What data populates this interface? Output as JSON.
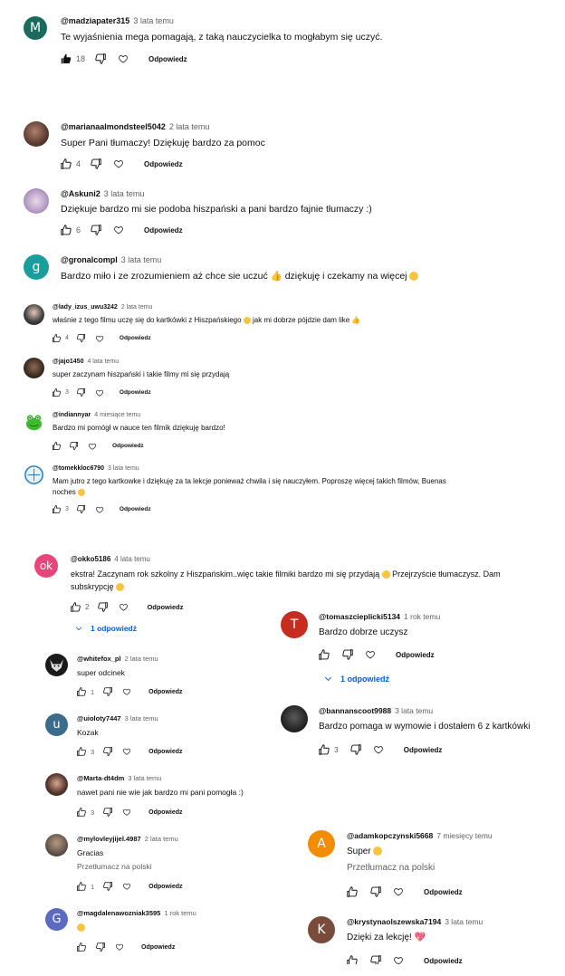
{
  "labels": {
    "reply": "Odpowiedz",
    "translate": "Przetłumacz na polski"
  },
  "colors": {
    "red": "#e8562f",
    "orange": "#f28c00",
    "green": "#1a9d8a",
    "pink": "#e8457a",
    "purple": "#5c6bc0",
    "brown": "#7a4b3a",
    "blue": "#065fd4"
  },
  "comments": [
    {
      "handle": "@madziapater315",
      "time": "3 lata temu",
      "text": "Te wyjaśnienia mega pomagają, z taką nauczycielka to mogłabym się uczyć.",
      "likes": "18",
      "avatar_letter": "M",
      "avatar_color": "#1a6b5e"
    },
    {
      "handle": "@marianaalmondsteel5042",
      "time": "2 lata temu",
      "text": "Super Pani tłumaczy! Dziękuję bardzo za pomoc",
      "likes": "4",
      "avatar_photo": "portrait"
    },
    {
      "handle": "@Askuni2",
      "time": "3 lata temu",
      "text": "Dziękuje bardzo mi sie podoba hiszpański a pani bardzo fajnie tłumaczy :)",
      "likes": "6",
      "avatar_photo": "anime"
    },
    {
      "handle": "@gronalcompl",
      "time": "3 lata temu",
      "text": "Bardzo miło i ze zrozumieniem aż chce sie uczuć",
      "text2": "dziękuję i czekamy na więcej",
      "avatar_letter": "g",
      "avatar_color": "#1a9d9d"
    },
    {
      "handle": "@lady_izus_uwu3242",
      "time": "2 lata temu",
      "text": "właśnie z tego filmu uczę się do kartkówki z Hiszpańskiego",
      "text2": "jak mi dobrze pójdzie dam like",
      "likes": "4",
      "avatar_photo": "portrait"
    },
    {
      "handle": "@jajo1450",
      "time": "4 lata temu",
      "text": "super zaczynam hiszpański i takie filmy mi się przydają",
      "likes": "3",
      "avatar_photo": "dark"
    },
    {
      "handle": "@indiannyar",
      "time": "4 miesiące temu",
      "text": "Bardzo mi pomógł w nauce ten filmik dziękuję bardzo!",
      "avatar_photo": "frog"
    },
    {
      "handle": "@tomekkloc6790",
      "time": "3 lata temu",
      "text": "Mam jutro z tego kartkowke i dziękuję za ta  lekcje ponieważ chwila i się nauczyłem. Poproszę więcej takich filmów, Buenas",
      "text2": "noches",
      "likes": "3",
      "avatar_photo": "logo"
    },
    {
      "handle": "@okko5186",
      "time": "4 lata temu",
      "text": "ekstra! Zaczynam rok szkolny z Hiszpańskim..więc takie filmiki bardzo mi się przydają",
      "text1b": "Przejrzyście tłumaczysz. Dam",
      "text2": "subskrypcję",
      "likes": "2",
      "avatar_letter": "ok",
      "avatar_color": "#e8457a",
      "replies": "1 odpowiedź"
    },
    {
      "handle": "@whitefox_pl",
      "time": "2 lata temu",
      "text": "super odcinek",
      "likes": "1",
      "avatar_photo": "fox"
    },
    {
      "handle": "@uioloty7447",
      "time": "3 lata temu",
      "text": "Kozak",
      "likes": "3",
      "avatar_letter": "u",
      "avatar_color": "#3c6c8c"
    },
    {
      "handle": "@Marta-dt4dm",
      "time": "3 lata temu",
      "text": "nawet pani nie wie jak bardzo mi pani pomogła :)",
      "likes": "3",
      "avatar_photo": "portrait"
    },
    {
      "handle": "@mylovleyjijel.4987",
      "time": "2 lata temu",
      "text": "Gracias",
      "likes": "1",
      "avatar_photo": "person"
    },
    {
      "handle": "@magdalenawozniak3595",
      "time": "1 rok temu",
      "text": "",
      "avatar_letter": "G",
      "avatar_color": "#5c6bc0"
    },
    {
      "handle": "@tomaszcieplicki5134",
      "time": "1 rok temu",
      "text": "Bardzo dobrze uczysz",
      "avatar_letter": "T",
      "avatar_color": "#c62d1f",
      "replies": "1 odpowiedź"
    },
    {
      "handle": "@bannanscoot9988",
      "time": "3 lata temu",
      "text": "Bardzo pomaga w wymowie i dostałem 6  z kartkówki",
      "likes": "3",
      "avatar_photo": "dark"
    },
    {
      "handle": "@adamkopczynski5668",
      "time": "7 miesięcy temu",
      "text": "Super",
      "avatar_letter": "A",
      "avatar_color": "#f28c00"
    },
    {
      "handle": "@krystynaolszewska7194",
      "time": "3 lata temu",
      "text": "Dzięki za lekcję!",
      "avatar_letter": "K",
      "avatar_color": "#7a4b3a"
    }
  ]
}
